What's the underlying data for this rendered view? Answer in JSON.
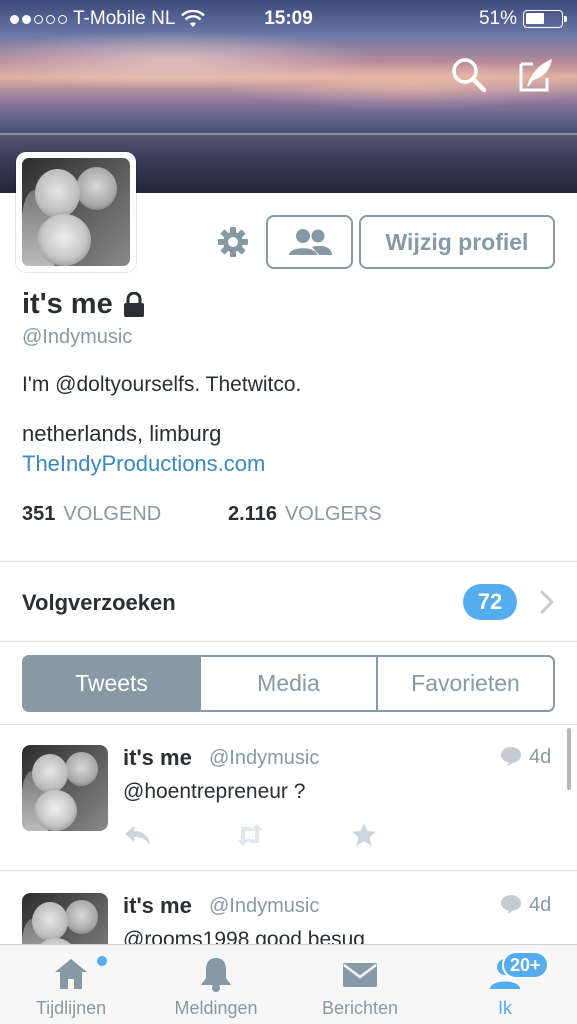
{
  "status_bar": {
    "carrier": "T-Mobile NL",
    "time": "15:09",
    "battery": "51%"
  },
  "header": {
    "search_icon": "search-icon",
    "compose_icon": "compose-icon"
  },
  "profile": {
    "name": "it's me",
    "handle": "@Indymusic",
    "bio": "I'm @doltyourselfs. Thetwitco.",
    "location": "netherlands, limburg",
    "website": "TheIndyProductions.com",
    "following_count": "351",
    "following_label": "VOLGEND",
    "followers_count": "2.116",
    "followers_label": "VOLGERS",
    "edit_label": "Wijzig profiel"
  },
  "follow_requests": {
    "label": "Volgverzoeken",
    "count": "72"
  },
  "tabs": [
    {
      "label": "Tweets",
      "active": true
    },
    {
      "label": "Media",
      "active": false
    },
    {
      "label": "Favorieten",
      "active": false
    }
  ],
  "tweets": [
    {
      "name": "it's me",
      "handle": "@Indymusic",
      "time": "4d",
      "text": "@hoentrepreneur ?"
    },
    {
      "name": "it's me",
      "handle": "@Indymusic",
      "time": "4d",
      "text": "@rooms1998 good besug"
    }
  ],
  "tabbar": {
    "items": [
      {
        "label": "Tijdlijnen",
        "icon": "home-icon"
      },
      {
        "label": "Meldingen",
        "icon": "bell-icon"
      },
      {
        "label": "Berichten",
        "icon": "envelope-icon"
      },
      {
        "label": "Ik",
        "icon": "person-icon"
      }
    ],
    "me_badge": "20+"
  },
  "colors": {
    "accent": "#55acee",
    "muted": "#8899a6",
    "text": "#292f33",
    "link": "#3b88c3"
  }
}
